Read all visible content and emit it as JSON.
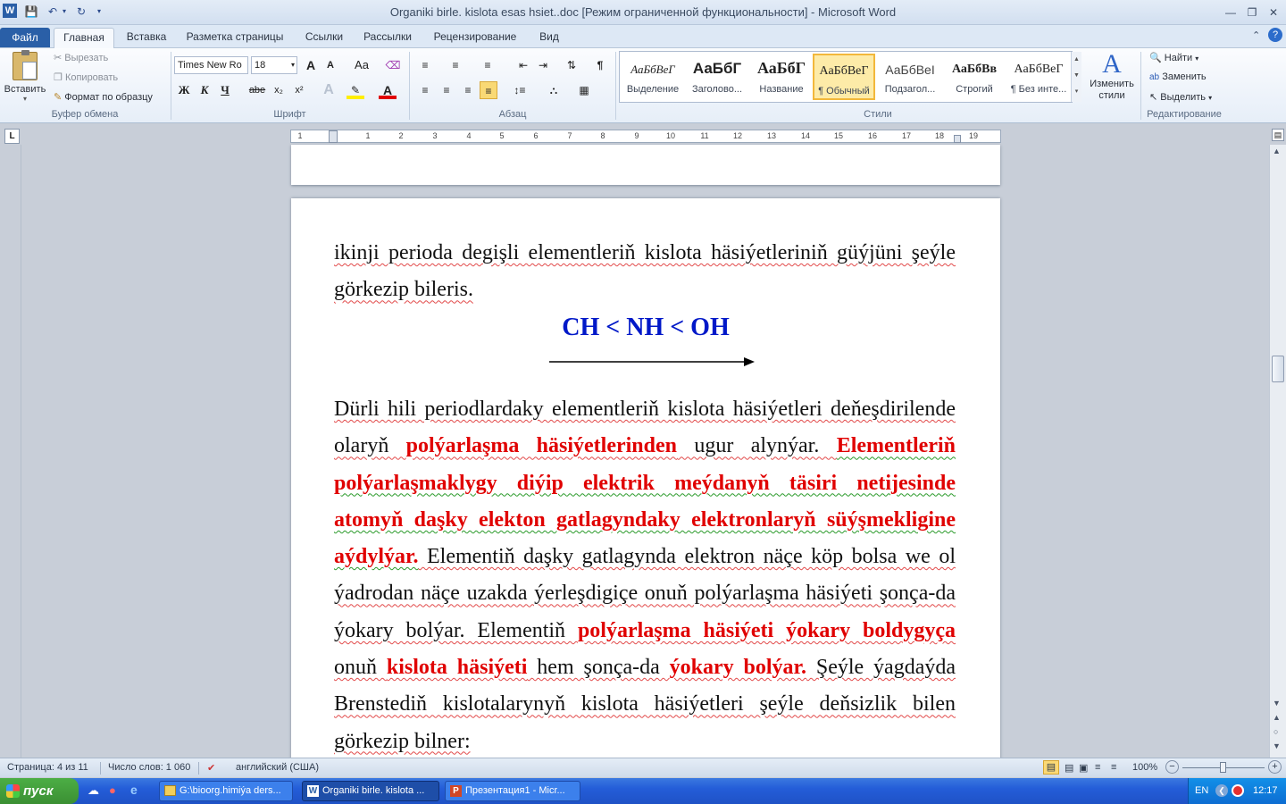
{
  "window": {
    "title": "Organiki birle. kislota esas hsiet..doc [Режим ограниченной функциональности]  -  Microsoft Word",
    "app_icon_letter": "W"
  },
  "tabs": [
    "Файл",
    "Главная",
    "Вставка",
    "Разметка страницы",
    "Ссылки",
    "Рассылки",
    "Рецензирование",
    "Вид"
  ],
  "active_tab": "Главная",
  "clipboard": {
    "paste": "Вставить",
    "cut": "Вырезать",
    "copy": "Копировать",
    "format_painter": "Формат по образцу",
    "group_label": "Буфер обмена"
  },
  "font": {
    "name": "Times New Ro",
    "size": "18",
    "group_label": "Шрифт",
    "bold": "Ж",
    "italic": "К",
    "underline": "Ч",
    "strike": "abe",
    "subscript": "x₂",
    "superscript": "x²",
    "grow": "A",
    "shrink": "A",
    "case": "Aa"
  },
  "paragraph_group": "Абзац",
  "styles": {
    "group_label": "Стили",
    "items": [
      {
        "sample": "АаБбВеГ",
        "name": "Выделение"
      },
      {
        "sample": "АаБбГ",
        "name": "Заголово..."
      },
      {
        "sample": "АаБбГ",
        "name": "Название"
      },
      {
        "sample": "АаБбВеГ",
        "name": "¶ Обычный"
      },
      {
        "sample": "АаБбВеІ",
        "name": "Подзагол..."
      },
      {
        "sample": "АаБбВв",
        "name": "Строгий"
      },
      {
        "sample": "АаБбВеГ",
        "name": "¶ Без инте..."
      }
    ],
    "change_styles": "Изменить стили"
  },
  "editing": {
    "find": "Найти",
    "replace": "Заменить",
    "select": "Выделить",
    "group_label": "Редактирование"
  },
  "ruler_numbers": [
    "1",
    "1",
    "2",
    "3",
    "4",
    "5",
    "6",
    "7",
    "8",
    "9",
    "10",
    "11",
    "12",
    "13",
    "14",
    "15",
    "16",
    "17",
    "18",
    "19"
  ],
  "document": {
    "para1": "ikinji perioda degişli elementleriň kislota häsiýetleriniň güýjüni şeýle görkezip bileris.",
    "formula": "CH < NH < OH",
    "para2": {
      "t1": "Dürli hili periodlardaky elementleriň kislota häsiýetleri deňeşdirilende olaryň ",
      "r1": "polýarlaşma häsiýetlerinden",
      "t2": " ugur alynýar. ",
      "r2": "Elementleriň polýarlaşmaklygy diýip elektrik meýdanyň täsiri netijesinde atomyň daşky elekton gatlagyndaky elektronlaryň süýşmekligine aýdylýar.",
      "t3": " Elementiň daşky gatlagynda elektron näçe köp bolsa we ol ýadrodan näçe uzakda ýerleşdigiçe onuň polýarlaşma häsiýeti şonça-da ýokary bolýar. Elementiň ",
      "r3": "polýarlaşma häsiýeti ýokary boldygyça",
      "t4": " onuň ",
      "r4": "kislota häsiýeti",
      "t5": " hem şonça-da ",
      "r5": "ýokary bolýar.",
      "t6": " Şeýle ýagdaýda Brenstediň kislotalarynyň kislota häsiýetleri şeýle deňsizlik bilen görkezip bilner:"
    }
  },
  "status": {
    "page": "Страница: 4 из 11",
    "words": "Число слов: 1 060",
    "language": "английский (США)",
    "zoom": "100%",
    "zoom_minus": "−",
    "zoom_plus": "+"
  },
  "taskbar": {
    "start": "пуск",
    "items": [
      "G:\\bioorg.himiýa ders...",
      "Organiki birle. kislota ...",
      "Презентация1 - Micr..."
    ],
    "lang": "EN",
    "clock": "12:17"
  }
}
